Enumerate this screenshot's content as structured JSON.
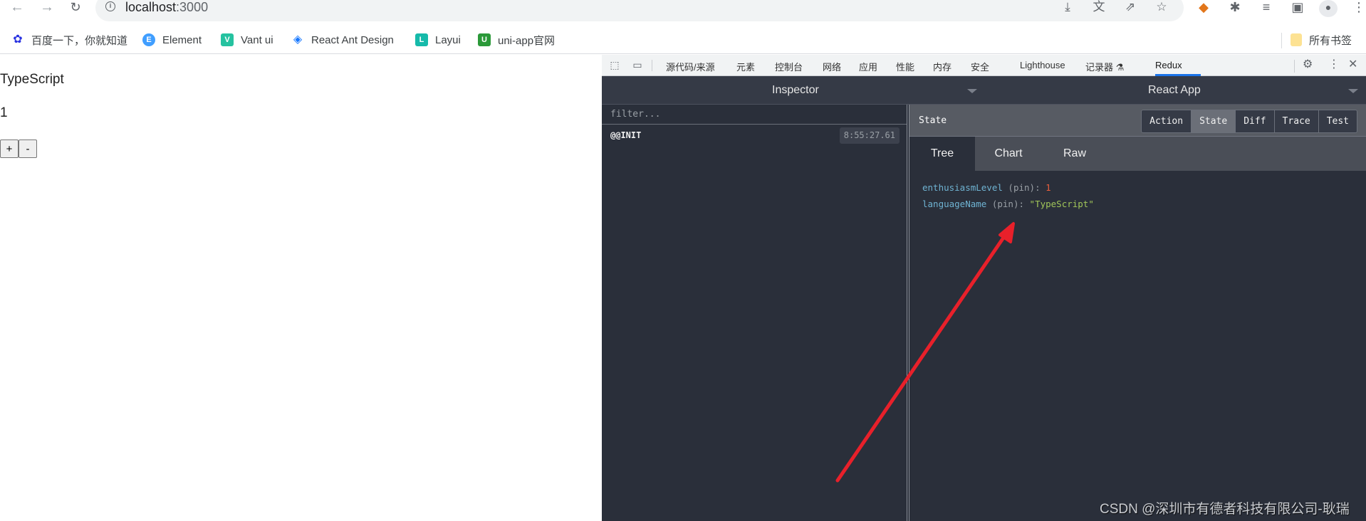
{
  "browser": {
    "url_host": "localhost",
    "url_port": ":3000",
    "nav": {
      "back": "←",
      "forward": "→",
      "reload": "↻"
    },
    "omnibox_icons": [
      "install-icon",
      "translate-icon",
      "share-icon",
      "bookmark-star-icon"
    ],
    "extension_icons": [
      "metamask-fox-icon",
      "extensions-puzzle-icon",
      "media-queue-icon",
      "side-panel-icon",
      "profile-avatar-icon",
      "menu-kebab-icon"
    ]
  },
  "bookmarks": {
    "items": [
      {
        "label": "百度一下，你就知道",
        "icon": "baidu-icon",
        "color": "#2932e1"
      },
      {
        "label": "Element",
        "icon": "element-icon",
        "color": "#409eff"
      },
      {
        "label": "Vant ui",
        "icon": "vant-icon",
        "color": "#07c160"
      },
      {
        "label": "React Ant Design",
        "icon": "ant-design-icon",
        "color": "#1677ff"
      },
      {
        "label": "Layui",
        "icon": "layui-icon",
        "color": "#16baaa"
      },
      {
        "label": "uni-app官网",
        "icon": "uniapp-icon",
        "color": "#2b9939"
      }
    ],
    "all_bookmarks": "所有书签"
  },
  "page": {
    "language_name": "TypeScript",
    "enthusiasm_level": "1",
    "increment_label": "+",
    "decrement_label": "-"
  },
  "devtools": {
    "tabs": [
      "源代码/来源",
      "元素",
      "控制台",
      "网络",
      "应用",
      "性能",
      "内存",
      "安全",
      "Lighthouse",
      "记录器",
      "Redux"
    ],
    "active_tab": "Redux",
    "redux": {
      "monitor_title": "Inspector",
      "instance_title": "React App",
      "filter_placeholder": "filter...",
      "actions": [
        {
          "name": "@@INIT",
          "time": "8:55:27.61"
        }
      ],
      "panel_label": "State",
      "segments": [
        "Action",
        "State",
        "Diff",
        "Trace",
        "Test"
      ],
      "active_segment": "State",
      "view_tabs": [
        "Tree",
        "Chart",
        "Raw"
      ],
      "active_view": "Tree",
      "state_tree": [
        {
          "key": "enthusiasmLevel",
          "pin": "(pin)",
          "value": "1",
          "type": "number"
        },
        {
          "key": "languageName",
          "pin": "(pin)",
          "value": "\"TypeScript\"",
          "type": "string"
        }
      ]
    }
  },
  "annotation": {
    "arrow_color": "#e8202a"
  },
  "watermark": "CSDN @深圳市有德者科技有限公司-耿瑞"
}
